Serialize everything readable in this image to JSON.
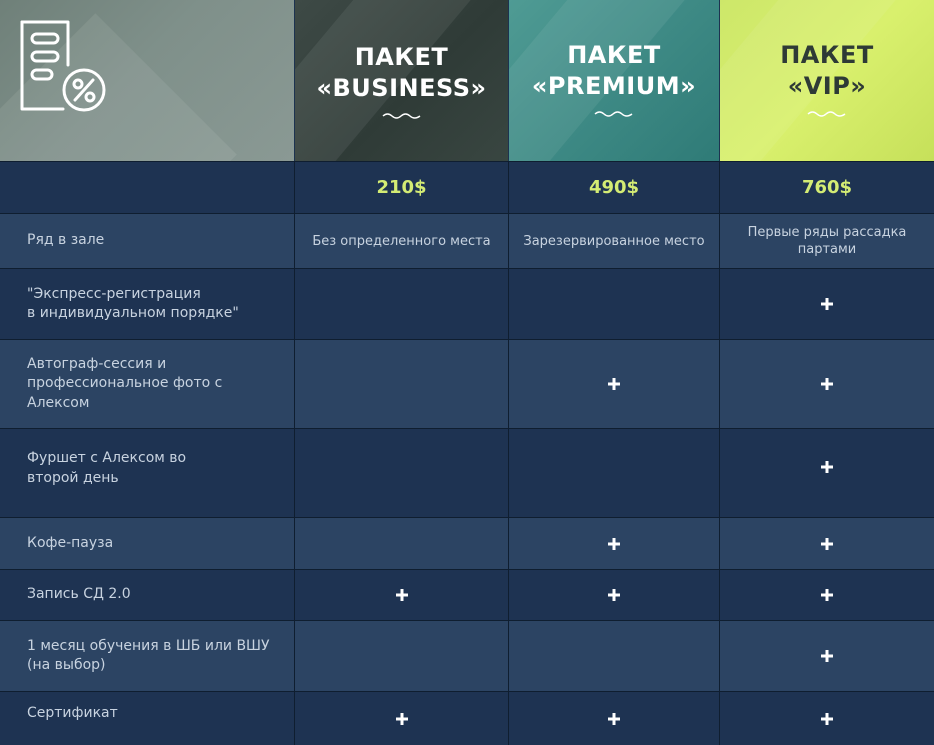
{
  "header": {
    "icon": "document-discount-icon",
    "packages": [
      {
        "line1": "ПАКЕТ",
        "line2": "«BUSINESS»"
      },
      {
        "line1": "ПАКЕТ",
        "line2": "«PREMIUM»"
      },
      {
        "line1": "ПАКЕТ",
        "line2": "«VIP»"
      }
    ]
  },
  "prices": [
    "210$",
    "490$",
    "760$"
  ],
  "rows": [
    {
      "label": "Ряд в зале",
      "business": "Без определенного места",
      "premium": "Зарезервированное место",
      "vip": "Первые ряды рассадка партами"
    },
    {
      "label": "\"Экспресс-регистрация\nв индивидуальном порядке\"",
      "business": false,
      "premium": false,
      "vip": true
    },
    {
      "label": "Автограф-сессия и\nпрофессиональное фото с\nАлексом",
      "business": false,
      "premium": true,
      "vip": true
    },
    {
      "label": "Фуршет с Алексом во\nвторой день",
      "business": false,
      "premium": false,
      "vip": true
    },
    {
      "label": "Кофе-пауза",
      "business": false,
      "premium": true,
      "vip": true
    },
    {
      "label": "Запись СД 2.0",
      "business": true,
      "premium": true,
      "vip": true
    },
    {
      "label": "1 месяц обучения в ШБ или ВШУ\n(на выбор)",
      "business": false,
      "premium": false,
      "vip": true
    },
    {
      "label": "Сертификат",
      "business": true,
      "premium": true,
      "vip": true
    }
  ],
  "colors": {
    "price": "#d4ec74",
    "business_header": "#35423e",
    "premium_header": "#3f8b86",
    "vip_header": "#d3ec6a",
    "row_dark": "#1e3352",
    "row_light": "#2c4463"
  },
  "icons": {
    "check": "plus-icon"
  }
}
